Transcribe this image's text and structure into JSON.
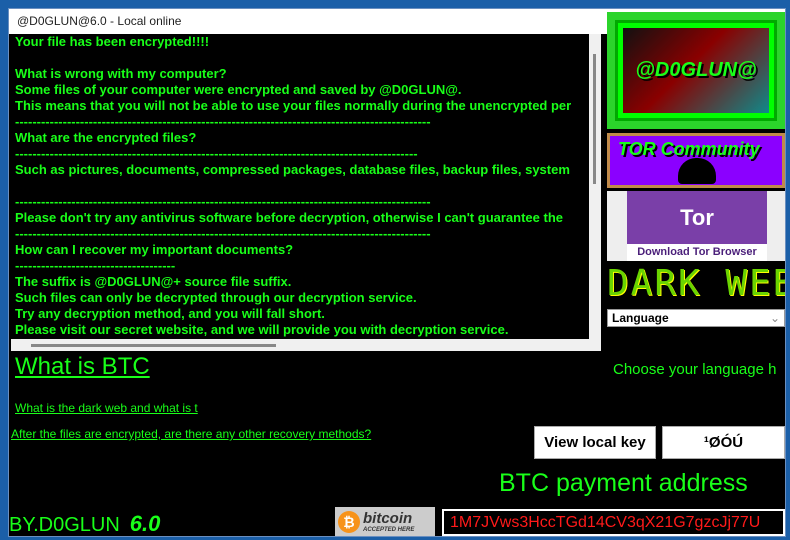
{
  "window": {
    "title": "@D0GLUN@6.0 - Local online"
  },
  "note": {
    "lines": [
      "Your file has been encrypted!!!!",
      "",
      "What is wrong with my computer?",
      "Some files of your computer were encrypted and saved by @D0GLUN@.",
      "This means that you will not be able to use your files normally during the unencrypted per",
      "------------------------------------------------------------------------------------------------",
      "What are the encrypted files?",
      "---------------------------------------------------------------------------------------------",
      "Such as pictures, documents, compressed packages, database files, backup files, system",
      "",
      "------------------------------------------------------------------------------------------------",
      "Please don't try any antivirus software before decryption, otherwise I can't guarantee the",
      "------------------------------------------------------------------------------------------------",
      "How can I recover my important documents?",
      "-------------------------------------",
      "The suffix is @D0GLUN@+ source file suffix.",
      "Such files can only be decrypted through our decryption service.",
      "Try any decryption method, and you will fall short.",
      "Please visit our secret website, and we will provide you with decryption service."
    ]
  },
  "sidebar": {
    "logo_text": "@D0GLUN@",
    "tor_community": "TOR Community",
    "tor_logo": "Tor",
    "download_tor": "Download Tor Browser",
    "dark_web": "DARK WEB",
    "language_select": "Language",
    "choose_language": "Choose your language h"
  },
  "links": {
    "what_is_btc": "What is BTC",
    "dark_web": "What is the dark web and what is t",
    "recovery": "After the files are encrypted, are there any other recovery methods?"
  },
  "key": {
    "view_button": "View local key",
    "value": "¹ØÓÚ"
  },
  "payment": {
    "label": "BTC payment address",
    "address": "1M7JVws3HccTGd14CV3qX21G7gzcJj77U",
    "bitcoin_badge": "bitcoin",
    "bitcoin_badge_sub": "ACCEPTED HERE"
  },
  "footer": {
    "by": "BY.D0GLUN",
    "version": "6.0"
  },
  "colors": {
    "text": "#19ff19",
    "background": "#000000",
    "address": "#ff1a1a",
    "tor_purple": "#8b00ff"
  }
}
